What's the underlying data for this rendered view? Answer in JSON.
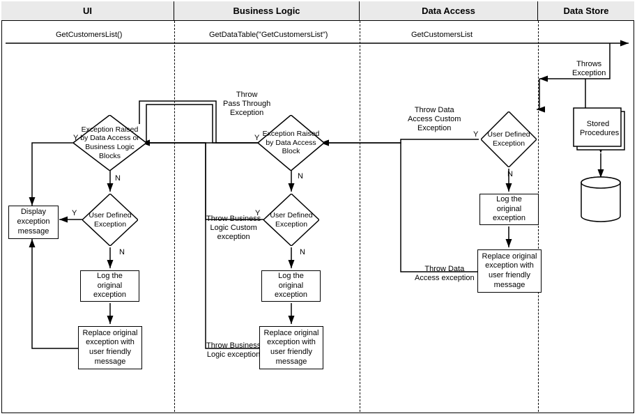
{
  "columns": {
    "ui": "UI",
    "bl": "Business Logic",
    "da": "Data Access",
    "ds": "Data Store"
  },
  "calls": {
    "ui_to_bl": "GetCustomersList()",
    "bl_to_da": "GetDataTable(\"GetCustomersList\")",
    "da_to_ds": "GetCustomersList"
  },
  "labels": {
    "throws_exception": "Throws\nException",
    "throw_pass_through": "Throw\nPass Through\nException",
    "throw_da_custom": "Throw Data\nAccess Custom\nException",
    "throw_da_exception": "Throw Data\nAccess exception",
    "throw_bl_custom": "Throw Business\nLogic Custom\nexception",
    "throw_bl_exception": "Throw Business\nLogic exception",
    "Y": "Y",
    "N": "N"
  },
  "diamonds": {
    "ui_raised": "Exception\nRaised by Data\nAccess or Business\nLogic Blocks",
    "ui_user": "User\nDefined\nException",
    "bl_raised": "Exception\nRaised by Data\nAccess Block",
    "bl_user": "User\nDefined\nException",
    "da_user": "User\nDefined\nException"
  },
  "boxes": {
    "display_msg": "Display\nexception\nmessage",
    "log_original": "Log the original\nexception",
    "replace_msg": "Replace original\nexception with\nuser friendly\nmessage",
    "stored_procs": "Stored\nProcedures"
  }
}
